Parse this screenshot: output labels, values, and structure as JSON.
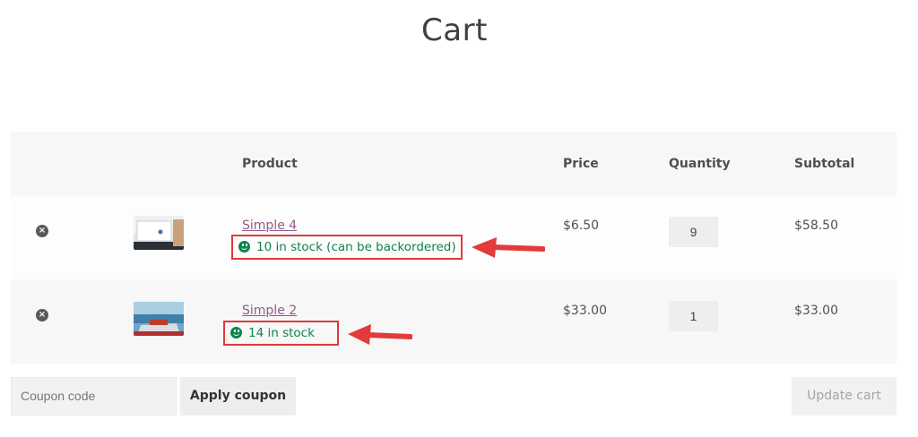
{
  "page": {
    "title": "Cart"
  },
  "table": {
    "headers": {
      "product": "Product",
      "price": "Price",
      "quantity": "Quantity",
      "subtotal": "Subtotal"
    },
    "rows": [
      {
        "remove": "×",
        "product": "Simple 4",
        "stock": "10 in stock (can be backordered)",
        "price": "$6.50",
        "quantity": "9",
        "subtotal": "$58.50"
      },
      {
        "remove": "×",
        "product": "Simple 2",
        "stock": "14 in stock",
        "price": "$33.00",
        "quantity": "1",
        "subtotal": "$33.00"
      }
    ]
  },
  "actions": {
    "coupon_placeholder": "Coupon code",
    "apply_label": "Apply coupon",
    "update_label": "Update cart"
  },
  "colors": {
    "link": "#96588a",
    "stock": "#0f834d",
    "highlight": "#e03a3a"
  },
  "icons": {
    "remove": "remove-circle-icon",
    "stock": "smiley-icon",
    "annotation": "arrow-left-icon"
  }
}
